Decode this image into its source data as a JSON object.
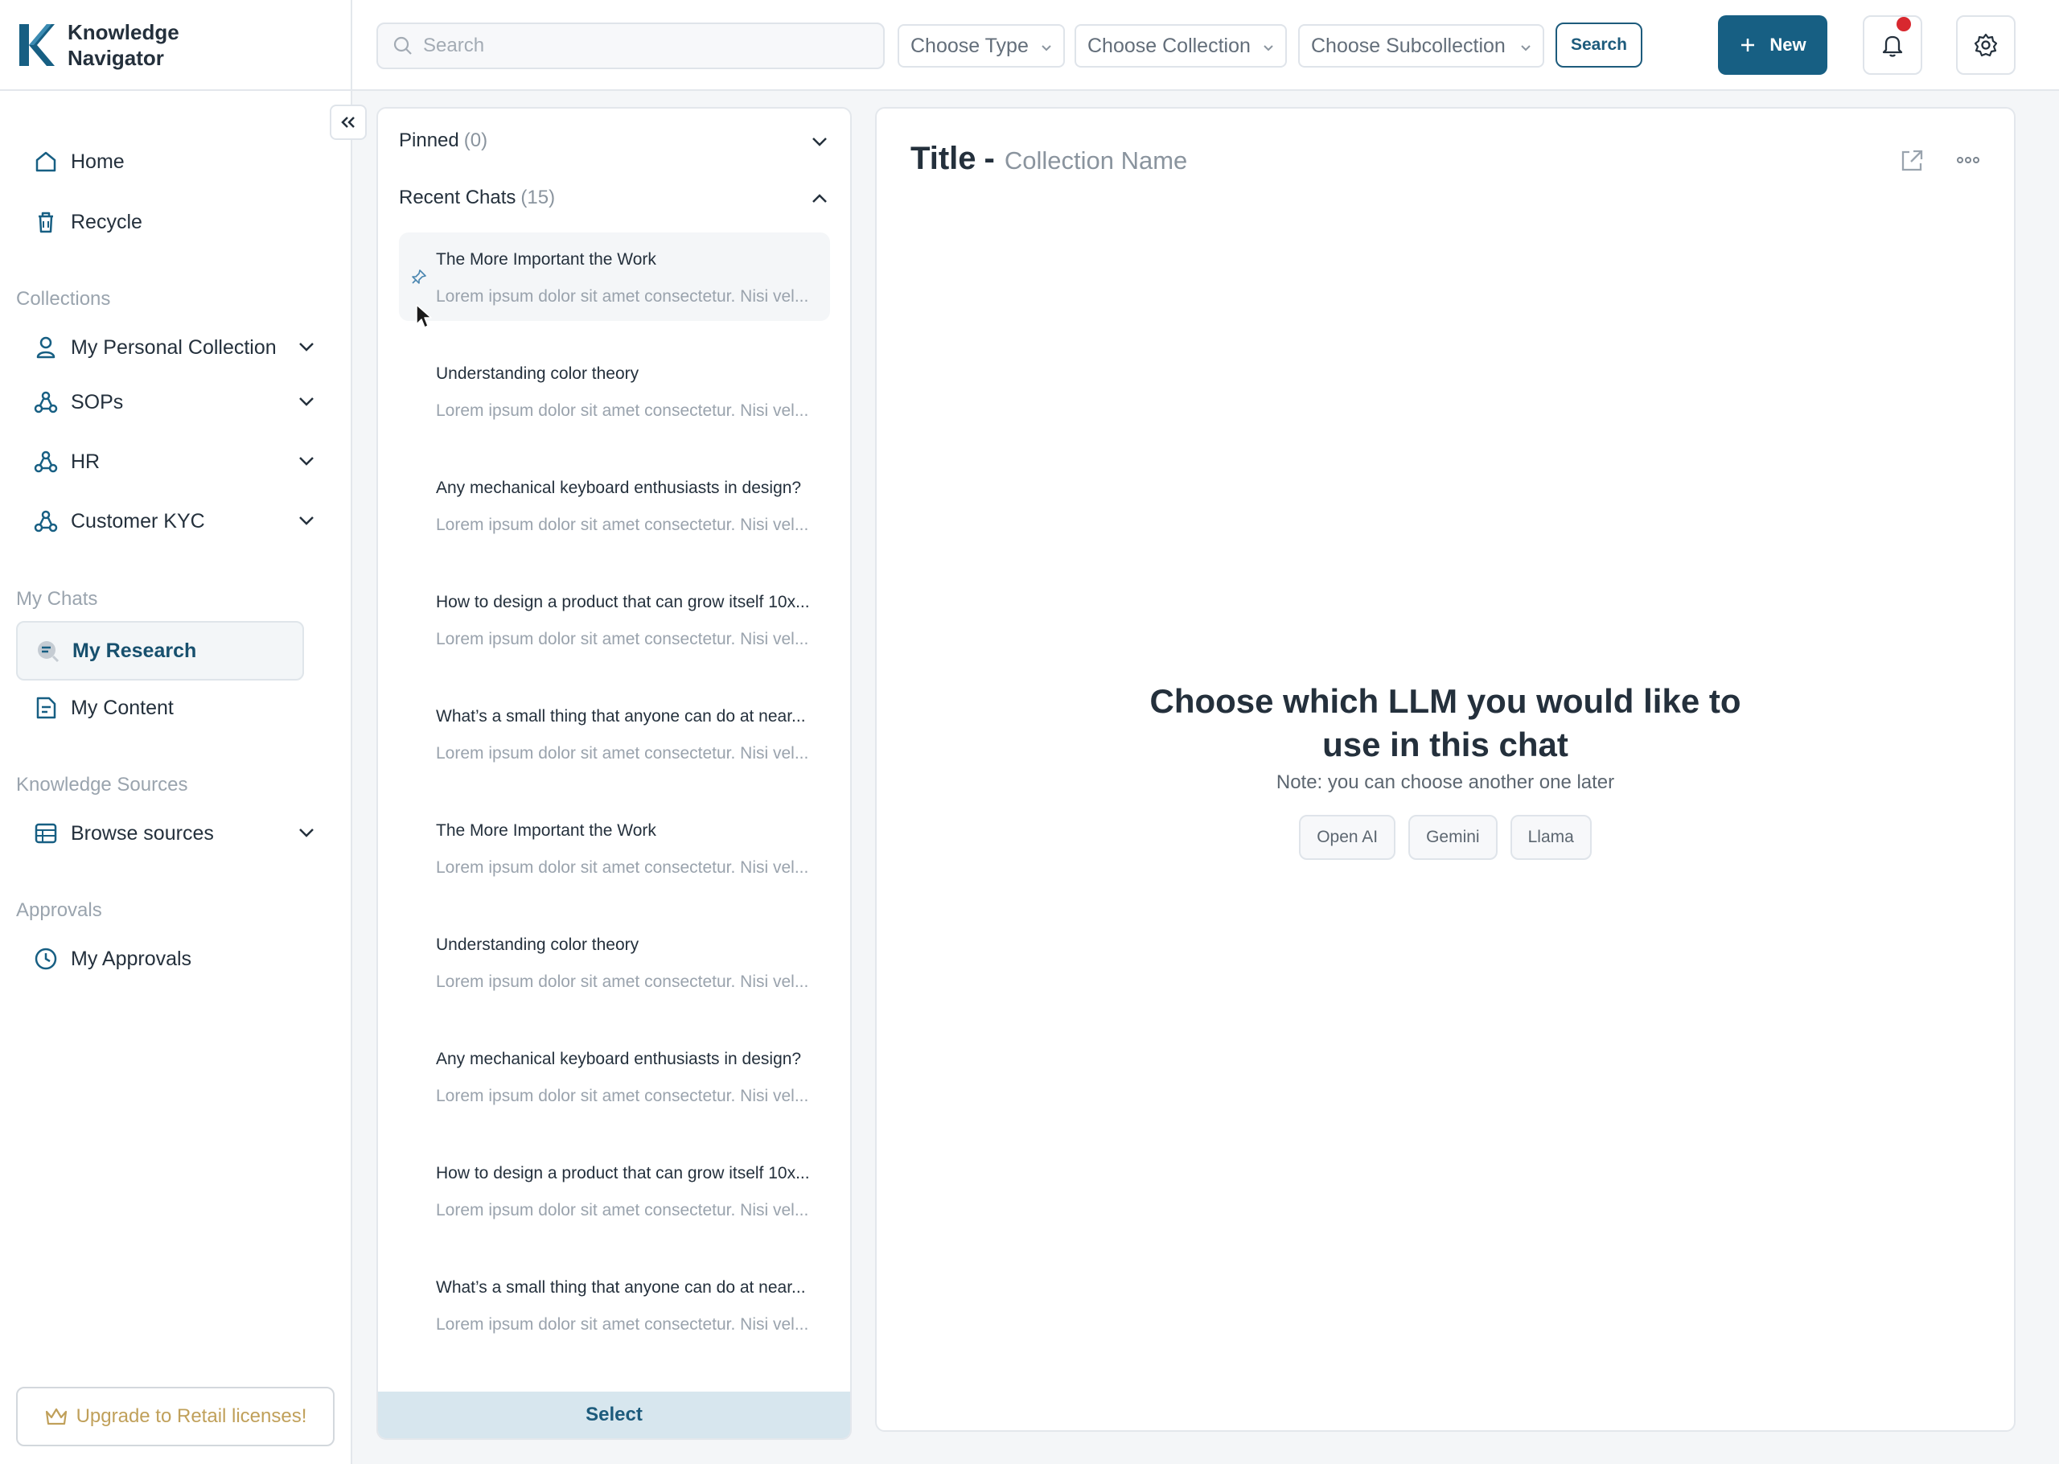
{
  "brand": {
    "name": "Knowledge Navigator"
  },
  "sidebar": {
    "home": "Home",
    "recycle": "Recycle",
    "collections_label": "Collections",
    "collections": [
      {
        "label": "My Personal Collection"
      },
      {
        "label": "SOPs"
      },
      {
        "label": "HR"
      },
      {
        "label": "Customer KYC"
      }
    ],
    "mychats_label": "My Chats",
    "my_research": "My Research",
    "my_content": "My Content",
    "knowledge_label": "Knowledge Sources",
    "browse_sources": "Browse sources",
    "approvals_label": "Approvals",
    "my_approvals": "My Approvals",
    "upgrade": "Upgrade to Retail licenses!"
  },
  "topbar": {
    "search_placeholder": "Search",
    "type_select": "Choose Type",
    "collection_select": "Choose Collection",
    "subcollection_select": "Choose Subcollection",
    "search_button": "Search",
    "new_button": "New",
    "notification_badge": true
  },
  "chatlist": {
    "pinned_label": "Pinned",
    "pinned_count": "(0)",
    "recent_label": "Recent Chats",
    "recent_count": "(15)",
    "select_button": "Select",
    "items": [
      {
        "title": "The More Important the Work",
        "preview": "Lorem ipsum dolor sit amet consectetur. Nisi vel..."
      },
      {
        "title": "Understanding color theory",
        "preview": "Lorem ipsum dolor sit amet consectetur. Nisi vel..."
      },
      {
        "title": "Any mechanical keyboard enthusiasts in design?",
        "preview": "Lorem ipsum dolor sit amet consectetur. Nisi vel..."
      },
      {
        "title": "How to design a product that can grow itself 10x...",
        "preview": "Lorem ipsum dolor sit amet consectetur. Nisi vel..."
      },
      {
        "title": "What’s a small thing that anyone can do at near...",
        "preview": "Lorem ipsum dolor sit amet consectetur. Nisi vel..."
      },
      {
        "title": "The More Important the Work",
        "preview": "Lorem ipsum dolor sit amet consectetur. Nisi vel..."
      },
      {
        "title": "Understanding color theory",
        "preview": "Lorem ipsum dolor sit amet consectetur. Nisi vel..."
      },
      {
        "title": "Any mechanical keyboard enthusiasts in design?",
        "preview": "Lorem ipsum dolor sit amet consectetur. Nisi vel..."
      },
      {
        "title": "How to design a product that can grow itself 10x...",
        "preview": "Lorem ipsum dolor sit amet consectetur. Nisi vel..."
      },
      {
        "title": "What’s a small thing that anyone can do at near...",
        "preview": "Lorem ipsum dolor sit amet consectetur. Nisi vel..."
      }
    ]
  },
  "main": {
    "title": "Title",
    "collection_name": "Collection Name",
    "llm_heading": "Choose which LLM you would like to use in this chat",
    "llm_note": "Note: you can choose another one later",
    "llm_options": [
      "Open AI",
      "Gemini",
      "Llama"
    ]
  },
  "colors": {
    "primary": "#175f83",
    "notification": "#d8282f",
    "upgrade": "#c0a05a"
  },
  "icons": [
    "search-icon",
    "home-icon",
    "recycle-icon",
    "user-icon",
    "collection-icon",
    "research-icon",
    "content-icon",
    "sources-icon",
    "clock-icon",
    "crown-icon",
    "bell-icon",
    "gear-icon",
    "pin-icon",
    "external-link-icon",
    "more-icon"
  ]
}
